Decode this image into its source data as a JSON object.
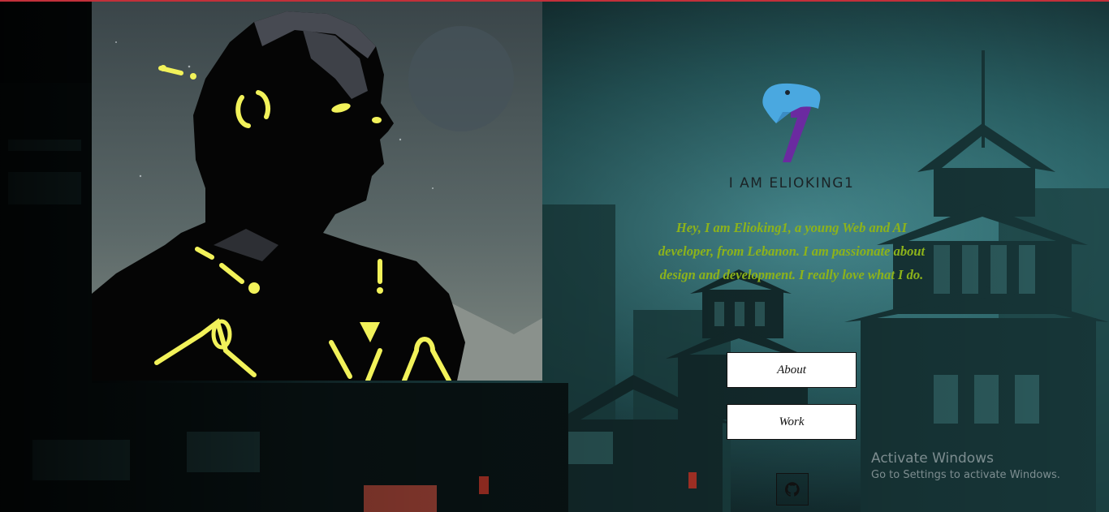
{
  "brand": {
    "title": "I AM ELIOKING1"
  },
  "bio": "Hey, I am Elioking1, a young Web and AI developer, from Lebanon. I am passionate about design and development. I really love what I do.",
  "nav": {
    "about_label": "About",
    "work_label": "Work"
  },
  "social": {
    "github_icon": "github-icon"
  },
  "system": {
    "activate_title": "Activate Windows",
    "activate_sub": "Go to Settings to activate Windows."
  },
  "colors": {
    "accent": "#c2303a",
    "bio_text": "#8db31a",
    "logo_blue": "#4aa8e0",
    "logo_purple": "#6b2aa0",
    "glow": "#f2f25a"
  }
}
